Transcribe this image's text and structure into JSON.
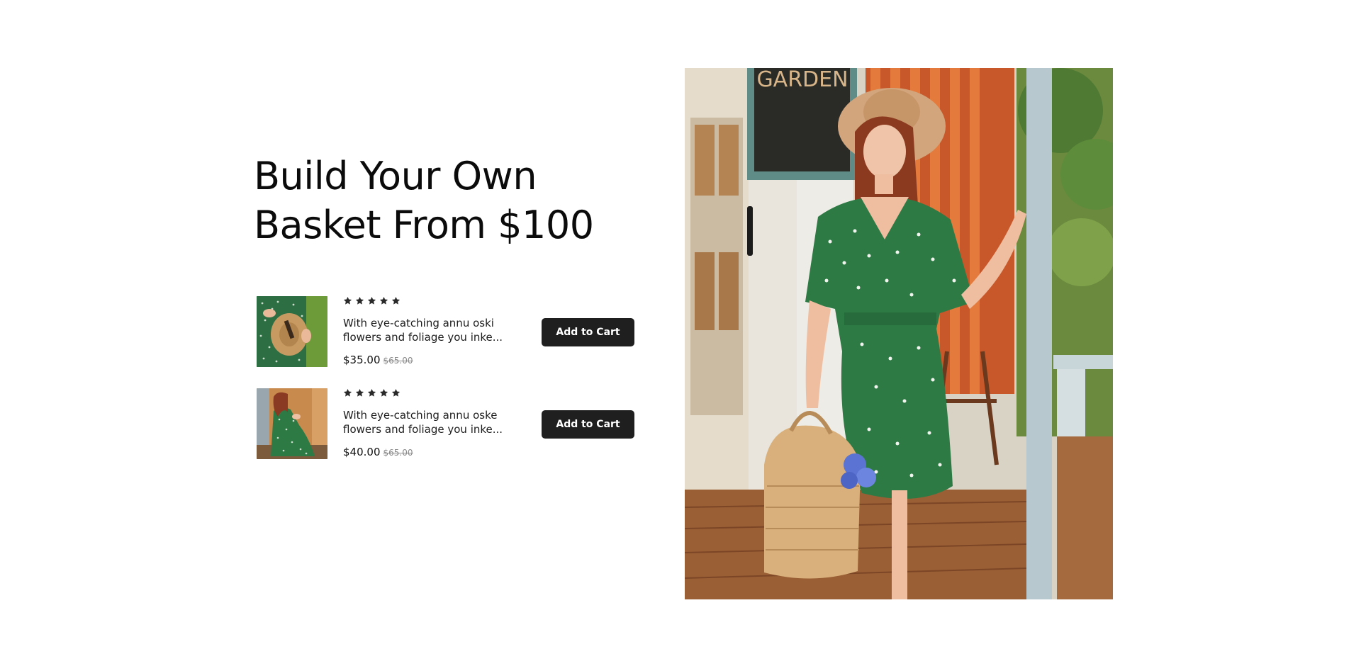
{
  "promo": {
    "headline_line1": "Build Your Own",
    "headline_line2": "Basket From $100"
  },
  "products": [
    {
      "rating": 5,
      "description_line1": "With eye-catching annu oski",
      "description_line2": "flowers and foliage you inke...",
      "price": "$35.00",
      "old_price": "$65.00",
      "button_label": "Add to Cart",
      "thumbnail": "woman-holding-straw-hat"
    },
    {
      "rating": 5,
      "description_line1": "With eye-catching annu oske",
      "description_line2": "flowers and foliage you inke...",
      "price": "$40.00",
      "old_price": "$65.00",
      "button_label": "Add to Cart",
      "thumbnail": "woman-seated-green-dress"
    }
  ],
  "hero_image": {
    "subject": "woman-in-green-polka-dot-dress-with-basket",
    "sign_text": "GARDEN"
  },
  "colors": {
    "button_bg": "#1f1f1f",
    "button_text": "#ffffff",
    "star": "#2a2a2a",
    "old_price": "#8a8a8a",
    "dress_green": "#2e7a45"
  }
}
